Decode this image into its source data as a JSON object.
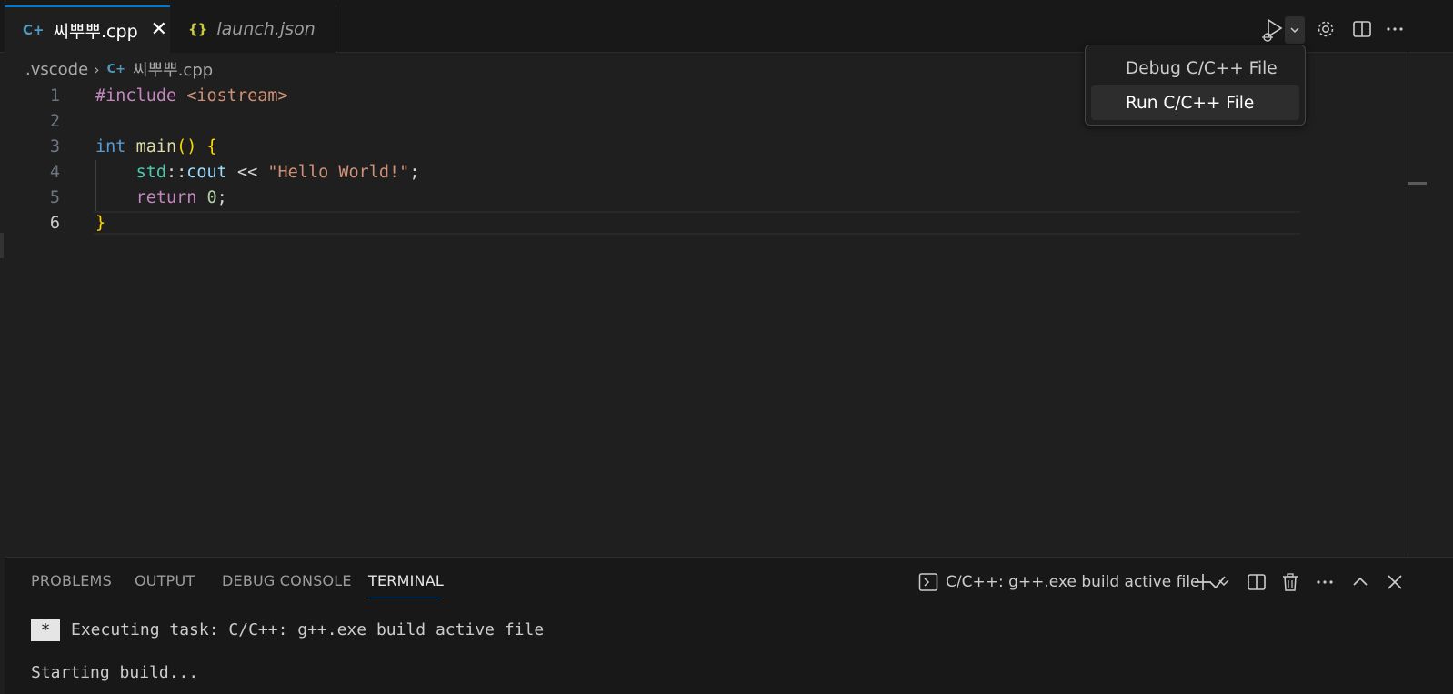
{
  "tabs": [
    {
      "icon": "C+",
      "label": "씨뿌뿌.cpp",
      "close": "✕"
    },
    {
      "icon": "{}",
      "label": "launch.json"
    }
  ],
  "breadcrumb": {
    "folder": ".vscode",
    "sep": "›",
    "icon": "C+",
    "file": "씨뿌뿌.cpp"
  },
  "editor": {
    "line_numbers": [
      "1",
      "2",
      "3",
      "4",
      "5",
      "6"
    ],
    "current_line": 6
  },
  "dropdown": {
    "items": [
      "Debug C/C++ File",
      "Run C/C++ File"
    ],
    "hovered_index": 1
  },
  "panel": {
    "tabs": [
      "PROBLEMS",
      "OUTPUT",
      "DEBUG CONSOLE",
      "TERMINAL"
    ],
    "active_tab": "TERMINAL",
    "task_label": "C/C++: g++.exe build active file"
  },
  "terminal": {
    "marker": "*",
    "lines": [
      "Executing task: C/C++: g++.exe build active file",
      "Starting build..."
    ]
  },
  "colors": {
    "accent": "#0078d4",
    "background": "#1f1f1f",
    "sidebar": "#181818"
  },
  "icons": [
    "cpp-file-icon",
    "json-file-icon",
    "run-debug-icon",
    "chevron-down-icon",
    "gear-icon",
    "split-editor-icon",
    "more-icon",
    "terminal-icon",
    "check-icon",
    "plus-icon",
    "trash-icon",
    "chevron-up-icon",
    "close-icon"
  ]
}
